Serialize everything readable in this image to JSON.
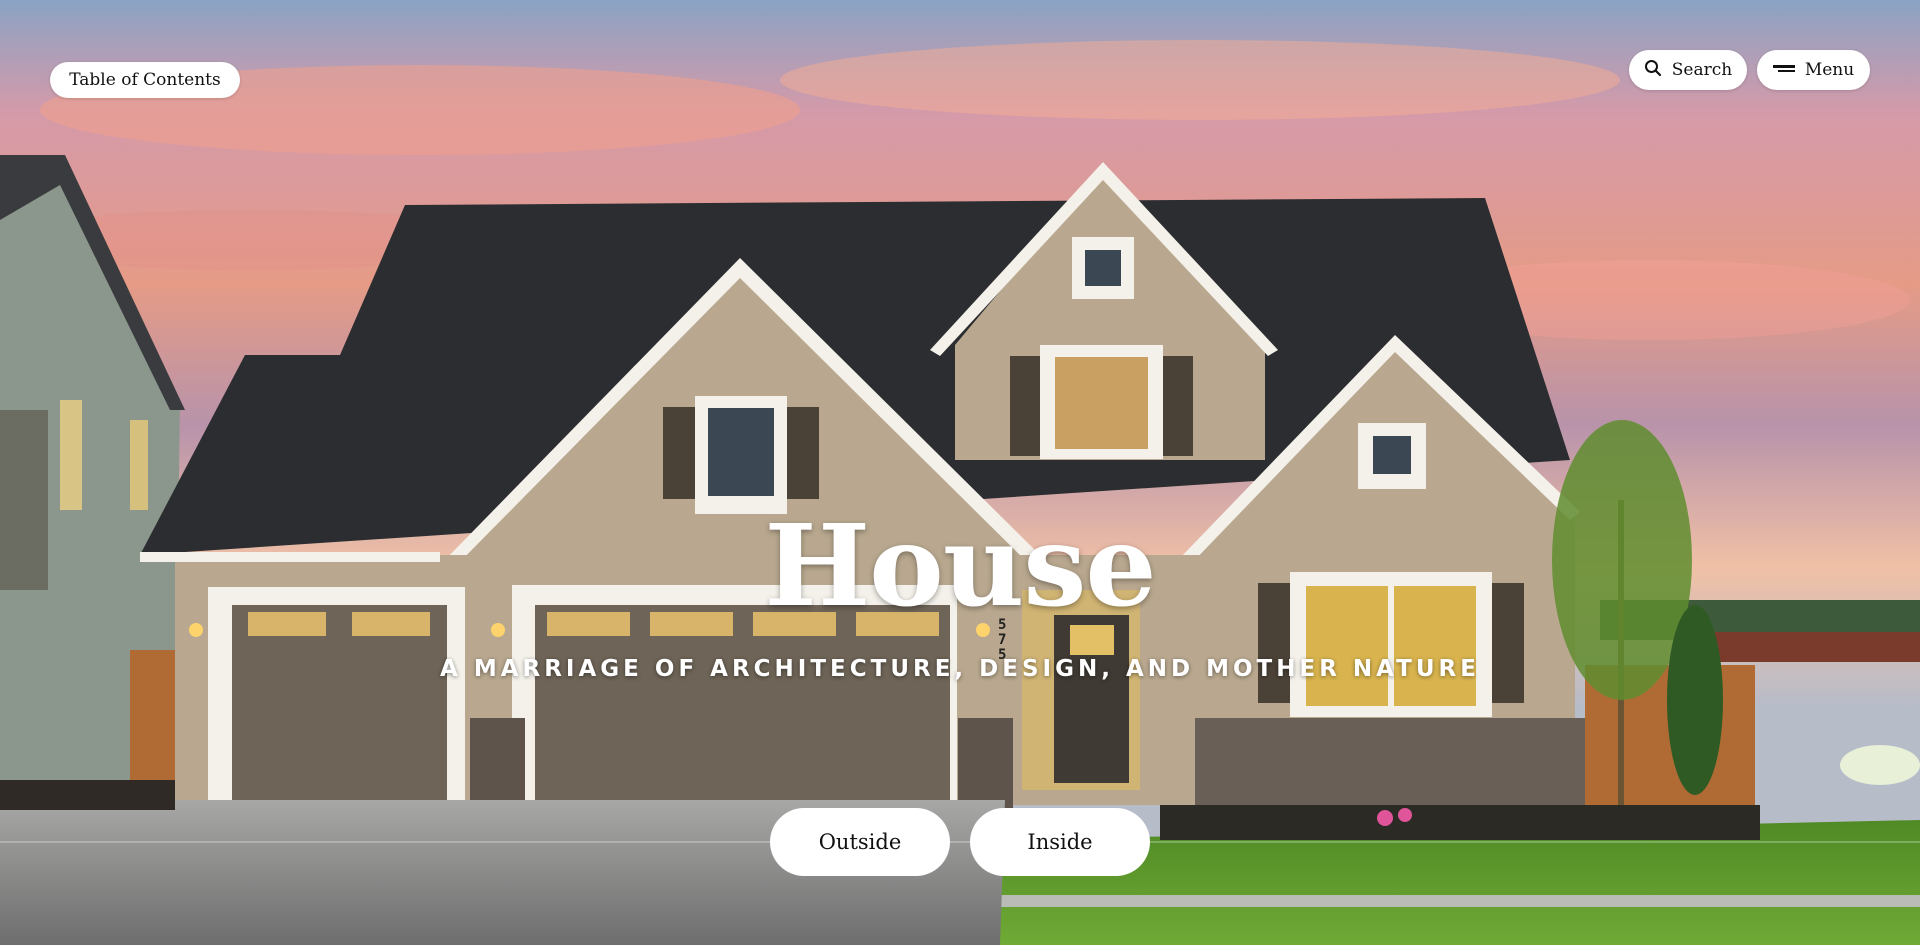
{
  "nav": {
    "toc_label": "Table of Contents",
    "search_label": "Search",
    "menu_label": "Menu"
  },
  "hero": {
    "title": "House",
    "subtitle": "A MARRIAGE OF ARCHITECTURE, DESIGN, AND MOTHER NATURE",
    "house_number": "575",
    "buttons": [
      {
        "label": "Outside"
      },
      {
        "label": "Inside"
      }
    ]
  },
  "colors": {
    "sky_top": "#8aa3c4",
    "sky_pink": "#e69c8c",
    "roof": "#2b2d30",
    "siding": "#b9a88f",
    "trim": "#f4f1ea",
    "lawn": "#5f9a2e",
    "button_bg": "#ffffff"
  },
  "icons": {
    "search": "search-icon",
    "menu": "menu-icon"
  }
}
